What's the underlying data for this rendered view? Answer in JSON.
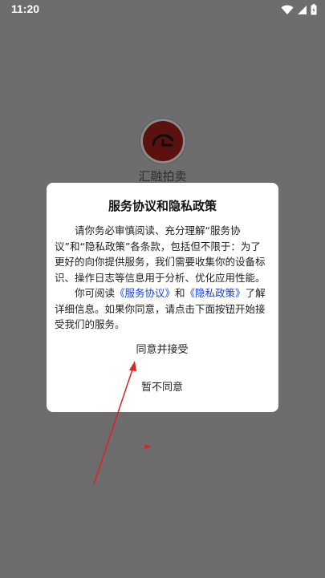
{
  "status_bar": {
    "time": "11:20",
    "icons": [
      "wifi-icon",
      "signal-icon",
      "battery-icon"
    ]
  },
  "app": {
    "name": "汇融拍卖",
    "logo_color": "#5c1111"
  },
  "dialog": {
    "title": "服务协议和隐私政策",
    "paragraph1": "请你务必审慎阅读、充分理解“服务协议”和“隐私政策”各条款，包括但不限于：为了更好的向你提供服务，我们需要收集你的设备标识、操作日志等信息用于分析、优化应用性能。",
    "paragraph2_prefix": "你可阅读",
    "link_service": "《服务协议》",
    "paragraph2_and": "和",
    "link_privacy": "《隐私政策》",
    "paragraph2_suffix": "了解详细信息。如果你同意，请点击下面按钮开始接受我们的服务。",
    "agree_label": "同意并接受",
    "disagree_label": "暂不同意"
  },
  "colors": {
    "overlay": "#6d6d6d",
    "link": "#1a3fd6",
    "annotation_arrow": "#e02020"
  }
}
